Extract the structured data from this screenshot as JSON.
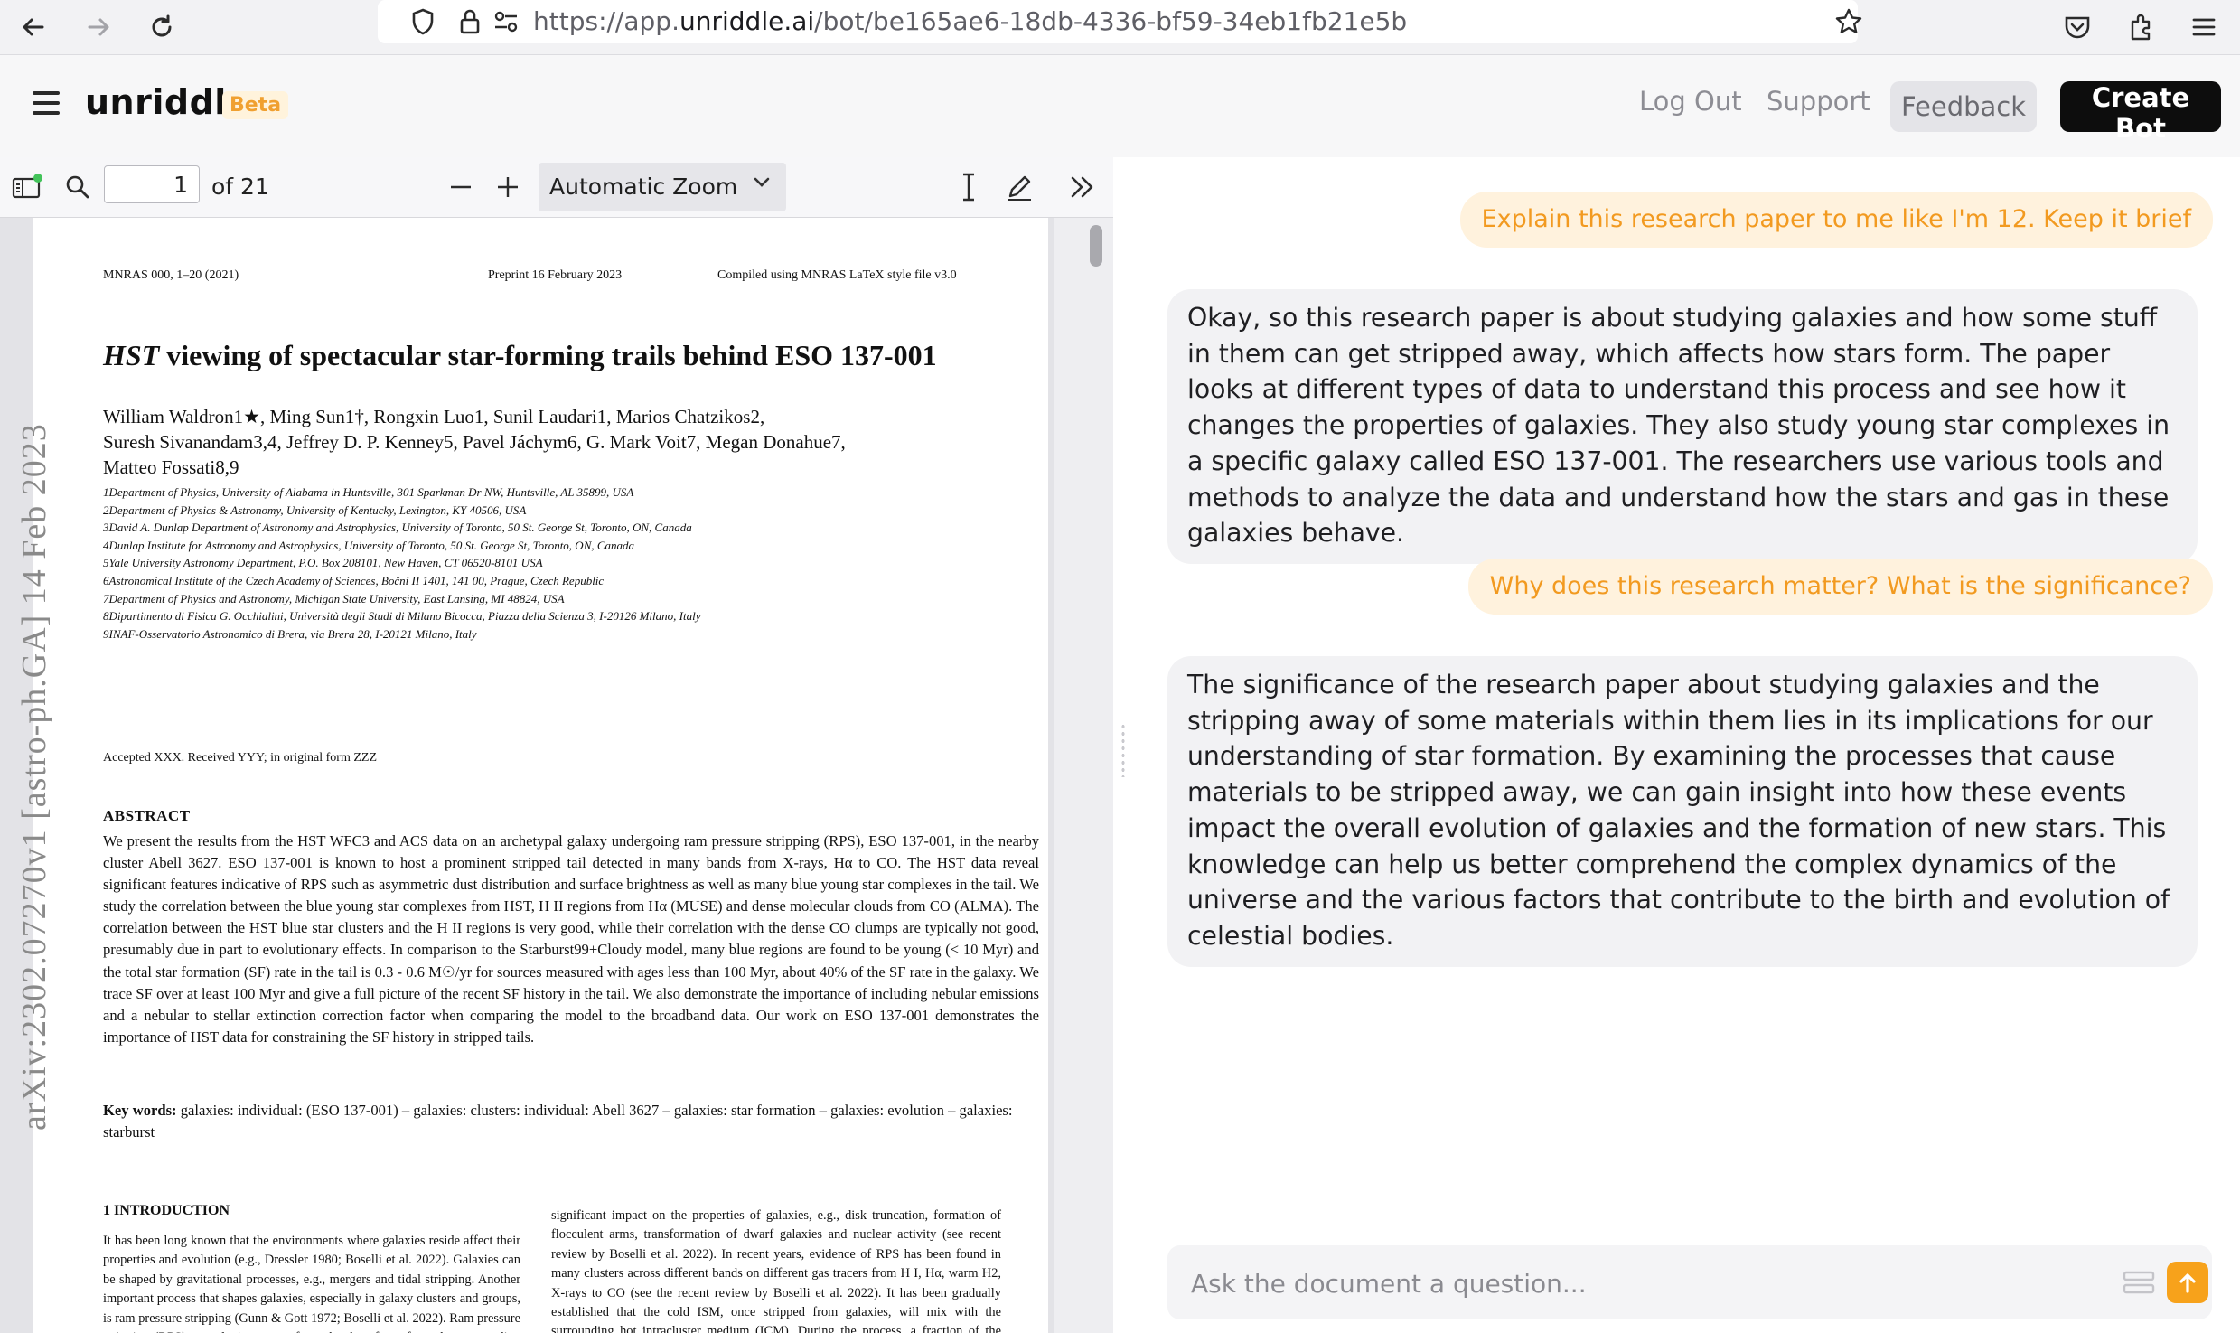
{
  "browser": {
    "url_scheme": "https://app.",
    "url_host": "unriddle.ai",
    "url_path": "/bot/be165ae6-18db-4336-bf59-34eb1fb21e5b"
  },
  "header": {
    "brand": "unriddle",
    "badge": "Beta",
    "logout_label": "Log Out",
    "support_label": "Support",
    "feedback_label": "Feedback",
    "create_bot_label": "Create Bot"
  },
  "pdf_viewer": {
    "page_number": "1",
    "page_total": "of 21",
    "zoom": "Automatic Zoom",
    "page": {
      "journal_ref": "MNRAS 000, 1–20 (2021)",
      "preprint": "Preprint 16 February 2023",
      "compiled": "Compiled using MNRAS LaTeX style file v3.0",
      "title_em": "HST",
      "title_rest": " viewing of spectacular star-forming trails behind ESO 137-001",
      "authors_line1": "William Waldron1★, Ming Sun1†, Rongxin Luo1, Sunil Laudari1, Marios Chatzikos2,",
      "authors_line2": "Suresh Sivanandam3,4, Jeffrey D. P. Kenney5, Pavel Jáchym6, G. Mark Voit7, Megan Donahue7,",
      "authors_line3": "Matteo Fossati8,9",
      "affiliations": [
        "1Department of Physics, University of Alabama in Huntsville, 301 Sparkman Dr NW, Huntsville, AL 35899, USA",
        "2Department of Physics & Astronomy, University of Kentucky, Lexington, KY 40506, USA",
        "3David A. Dunlap Department of Astronomy and Astrophysics, University of Toronto, 50 St. George St, Toronto, ON, Canada",
        "4Dunlap Institute for Astronomy and Astrophysics, University of Toronto, 50 St. George St, Toronto, ON, Canada",
        "5Yale University Astronomy Department, P.O. Box 208101, New Haven, CT 06520-8101 USA",
        "6Astronomical Institute of the Czech Academy of Sciences, Boční II 1401, 141 00, Prague, Czech Republic",
        "7Department of Physics and Astronomy, Michigan State University, East Lansing, MI 48824, USA",
        "8Dipartimento di Fisica G. Occhialini, Università degli Studi di Milano Bicocca, Piazza della Scienza 3, I-20126 Milano, Italy",
        "9INAF-Osservatorio Astronomico di Brera, via Brera 28, I-20121 Milano, Italy"
      ],
      "accepted": "Accepted XXX. Received YYY; in original form ZZZ",
      "abstract_heading": "ABSTRACT",
      "abstract": "We present the results from the HST WFC3 and ACS data on an archetypal galaxy undergoing ram pressure stripping (RPS), ESO 137-001, in the nearby cluster Abell 3627. ESO 137-001 is known to host a prominent stripped tail detected in many bands from X-rays, Hα to CO. The HST data reveal significant features indicative of RPS such as asymmetric dust distribution and surface brightness as well as many blue young star complexes in the tail. We study the correlation between the blue young star complexes from HST, H II regions from Hα (MUSE) and dense molecular clouds from CO (ALMA). The correlation between the HST blue star clusters and the H II regions is very good, while their correlation with the dense CO clumps are typically not good, presumably due in part to evolutionary effects. In comparison to the Starburst99+Cloudy model, many blue regions are found to be young (< 10 Myr) and the total star formation (SF) rate in the tail is 0.3 - 0.6 M☉/yr for sources measured with ages less than 100 Myr, about 40% of the SF rate in the galaxy. We trace SF over at least 100 Myr and give a full picture of the recent SF history in the tail. We also demonstrate the importance of including nebular emissions and a nebular to stellar extinction correction factor when comparing the model to the broadband data. Our work on ESO 137-001 demonstrates the importance of HST data for constraining the SF history in stripped tails.",
      "keywords_label": "Key words:",
      "keywords": "galaxies: individual: (ESO 137-001) – galaxies: clusters: individual: Abell 3627 – galaxies: star formation – galaxies: evolution – galaxies: starburst",
      "intro_heading": "1 INTRODUCTION",
      "intro_left": "It has been long known that the environments where galaxies reside affect their properties and evolution (e.g., Dressler 1980; Boselli et al. 2022). Galaxies can be shaped by gravitational processes, e.g., mergers and tidal stripping. Another important process that shapes galaxies, especially in galaxy clusters and groups, is ram pressure stripping (Gunn & Gott 1972; Boselli et al. 2022). Ram pressure stripping (RPS) on galaxies comes from the drag force from the surrounding medium that is proportional to its density and the square of",
      "intro_right": "significant impact on the properties of galaxies, e.g., disk truncation, formation of flocculent arms, transformation of dwarf galaxies and nuclear activity (see recent review by Boselli et al. 2022). In recent years, evidence of RPS has been found in many clusters across different bands on different gas tracers from H I, Hα, warm H2, X-rays to CO (see the recent review by Boselli et al. 2022). It has been gradually established that the cold ISM, once stripped from galaxies, will mix with the surrounding hot intracluster medium (ICM). During the process, a fraction of the stripped ISM can cool to form stars in the tails, while the bulk will eventually be evaporated (e.g.,",
      "arxiv_stamp": "arXiv:2302.07270v1  [astro-ph.GA]  14 Feb 2023"
    }
  },
  "chat": {
    "messages": [
      {
        "role": "user",
        "text": "Explain this research paper to me like I'm 12. Keep it brief"
      },
      {
        "role": "bot",
        "text": "Okay, so this research paper is about studying galaxies and how some stuff in them can get stripped away, which affects how stars form. The paper looks at different types of data to understand this process and see how it changes the properties of galaxies. They also study young star complexes in a specific galaxy called ESO 137-001. The researchers use various tools and methods to analyze the data and understand how the stars and gas in these galaxies behave."
      },
      {
        "role": "user",
        "text": "Why does this research matter? What is the significance?"
      },
      {
        "role": "bot",
        "text": "The significance of the research paper about studying galaxies and the stripping away of some materials within them lies in its implications for our understanding of star formation. By examining the processes that cause materials to be stripped away, we can gain insight into how these events impact the overall evolution of galaxies and the formation of new stars. This knowledge can help us better comprehend the complex dynamics of the universe and the various factors that contribute to the birth and evolution of celestial bodies."
      }
    ],
    "input_placeholder": "Ask the document a question..."
  },
  "colors": {
    "accent": "#f7a21b",
    "user_bubble_bg": "#fff2dd",
    "user_bubble_text": "#f29a20",
    "bot_bubble_bg": "#f2f2f4",
    "create_bot_bg": "#0d0d0d"
  },
  "icons": [
    "back-arrow-icon",
    "forward-arrow-icon",
    "reload-icon",
    "shield-icon",
    "lock-icon",
    "permissions-icon",
    "bookmark-star-icon",
    "pocket-icon",
    "extensions-icon",
    "browser-menu-icon",
    "hamburger-menu-icon",
    "sidebar-toggle-icon",
    "search-icon",
    "zoom-out-icon",
    "zoom-in-icon",
    "chevron-down-icon",
    "text-cursor-icon",
    "draw-pen-icon",
    "double-chevron-right-icon",
    "document-icon",
    "send-arrow-up-icon"
  ]
}
